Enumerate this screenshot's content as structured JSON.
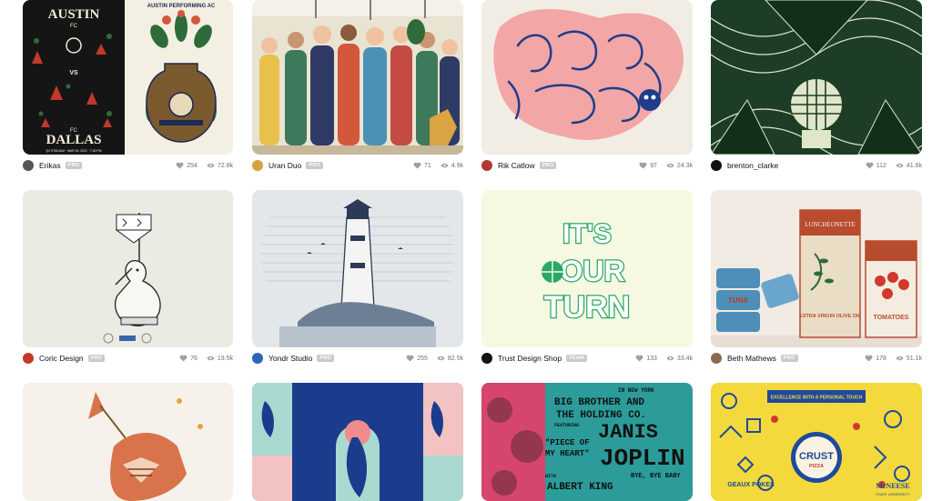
{
  "shots": [
    {
      "author": "Erikas",
      "badge": "PRO",
      "likes": "254",
      "views": "72.8k",
      "bg": "#f4efe3",
      "avatar": "#555555"
    },
    {
      "author": "Uran Duo",
      "badge": "PRO",
      "likes": "71",
      "views": "4.9k",
      "bg": "#e9e3d2",
      "avatar": "#d8a13a"
    },
    {
      "author": "Rik Catlow",
      "badge": "PRO",
      "likes": "97",
      "views": "24.3k",
      "bg": "#f2ede4",
      "avatar": "#b03a2e"
    },
    {
      "author": "brenton_clarke",
      "badge": "",
      "likes": "112",
      "views": "41.6k",
      "bg": "#1d3d26",
      "avatar": "#111111"
    },
    {
      "author": "Coric Design",
      "badge": "PRO",
      "likes": "76",
      "views": "19.5k",
      "bg": "#ecebe3",
      "avatar": "#c0392b"
    },
    {
      "author": "Yondr Studio",
      "badge": "PRO",
      "likes": "255",
      "views": "82.5k",
      "bg": "#e4e7ea",
      "avatar": "#2a66b8"
    },
    {
      "author": "Trust Design Shop",
      "badge": "TEAM",
      "likes": "133",
      "views": "33.4k",
      "bg": "#f6f8e1",
      "avatar": "#111111"
    },
    {
      "author": "Beth Mathews",
      "badge": "PRO",
      "likes": "178",
      "views": "51.1k",
      "bg": "#f1ebe4",
      "avatar": "#8a6b52"
    },
    {
      "author": "",
      "badge": "",
      "likes": "",
      "views": "",
      "bg": "#f6f1ea",
      "avatar": ""
    },
    {
      "author": "",
      "badge": "",
      "likes": "",
      "views": "",
      "bg": "#1b3b8c",
      "avatar": ""
    },
    {
      "author": "",
      "badge": "",
      "likes": "",
      "views": "",
      "bg": "#2c9c9a",
      "avatar": ""
    },
    {
      "author": "",
      "badge": "",
      "likes": "",
      "views": "",
      "bg": "#f3d93b",
      "avatar": ""
    }
  ],
  "art_text": {
    "austin_title": "AUSTIN",
    "austin_fc": "FC",
    "austin_vs": "VS",
    "dallas_fc": "FC",
    "dallas_title": "DALLAS",
    "austin_strip": "Q2 STADIUM · MAR 26, 2022 · 7:30 PM",
    "arts_title": "AUSTIN PERFORMING AC",
    "turn_line1": "IT'S",
    "turn_line2": "OUR",
    "turn_line3": "TURN",
    "tin1_brand": "LUNCHEONETTE",
    "tin1_product": "EXTRA VIRGIN OLIVE OIL",
    "tin2_product": "TOMATOES",
    "tuna_label": "TUNA",
    "joplin_top": "IN NEW YORK",
    "joplin_band1": "BIG BROTHER AND",
    "joplin_band2": "THE HOLDING CO.",
    "joplin_featuring": "FEATURING",
    "joplin_name1": "JANIS",
    "joplin_name2": "JOPLIN",
    "joplin_song1": "\"PIECE OF",
    "joplin_song2": "MY HEART\"",
    "joplin_bye": "BYE, BYE BABY",
    "joplin_with": "WITH",
    "joplin_albert": "ALBERT KING",
    "crust_banner": "EXCELLENCE WITH A PERSONAL TOUCH",
    "crust_word": "CRUST",
    "crust_pizza": "PIZZA",
    "crust_geaux": "GEAUX POKES",
    "crust_mcneese": "McNEESE",
    "crust_state": "STATE UNIVERSITY"
  }
}
